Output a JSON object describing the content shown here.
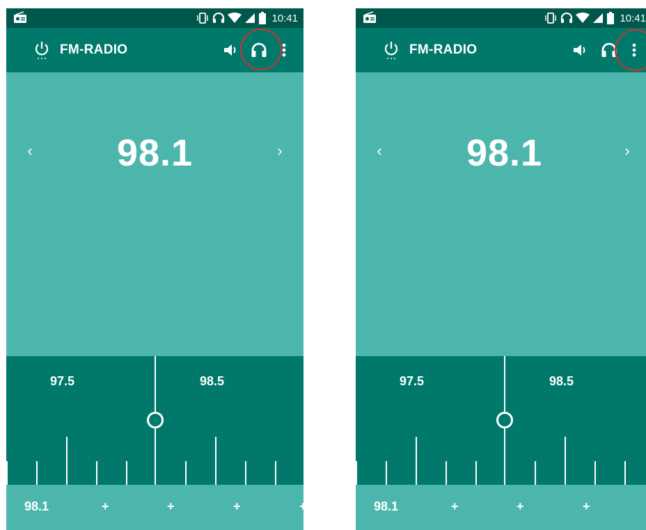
{
  "app": {
    "title": "FM-RADIO",
    "status_time": "10:41",
    "frequency": "98.1",
    "prev_arrow": "‹",
    "next_arrow": "›"
  },
  "tuner": {
    "labels": [
      "97.5",
      "98.5"
    ]
  },
  "presets": [
    "98.1",
    "+",
    "+",
    "+",
    "+"
  ],
  "icons": {
    "status": [
      "radio-icon",
      "vibrate-icon",
      "headset-icon",
      "wifi-icon",
      "signal-icon",
      "battery-icon"
    ],
    "appbar": [
      "power-icon",
      "speaker-icon",
      "headphones-icon",
      "more-vert-icon"
    ]
  },
  "colors": {
    "status_bar": "#00574B",
    "app_bar": "#00796B",
    "main_bg": "#4DB6AC",
    "tuner_bg": "#00796B",
    "annotation": "#D32F2F"
  },
  "panels": [
    {
      "id": "left",
      "highlight": "headphones-button"
    },
    {
      "id": "right",
      "highlight": "more-options-button"
    }
  ]
}
